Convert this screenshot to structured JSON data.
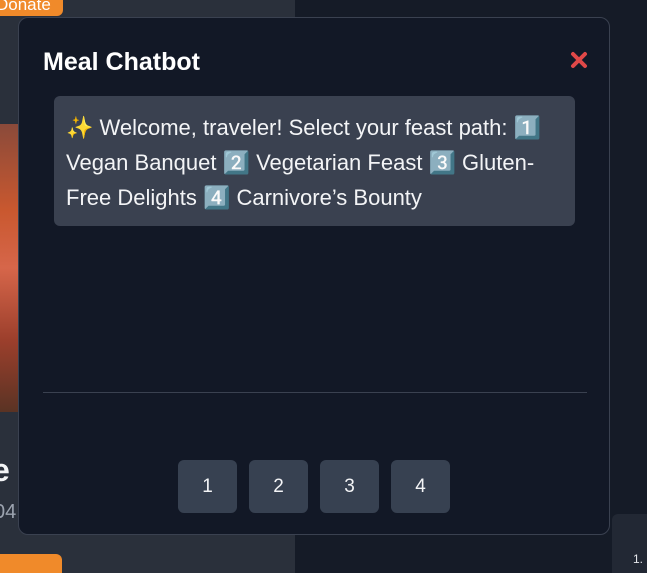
{
  "background": {
    "donate_label": "Donate",
    "heading_fragment": "e",
    "sub_fragment": "04",
    "right_card_text": "1."
  },
  "modal": {
    "title": "Meal Chatbot",
    "close_icon": "close-x-icon",
    "message": "✨ Welcome, traveler! Select your feast path: 1️⃣ Vegan Banquet 2️⃣ Vegetarian Feast 3️⃣ Gluten-Free Delights 4️⃣ Carnivore’s Bounty",
    "options": [
      "1",
      "2",
      "3",
      "4"
    ]
  },
  "colors": {
    "accent_orange": "#f08a2a",
    "close_red": "#e04848",
    "modal_bg": "#121826",
    "bubble_bg": "#3a4150"
  }
}
